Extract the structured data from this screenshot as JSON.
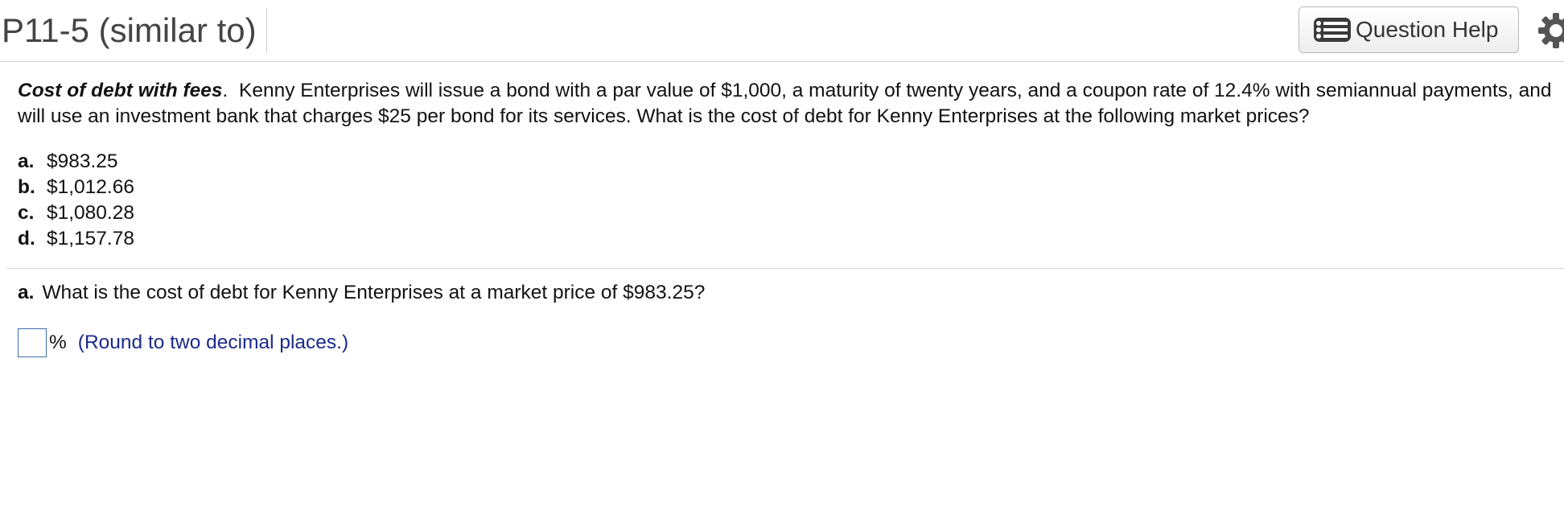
{
  "header": {
    "title": "P11-5 (similar to)",
    "help_label": "Question Help"
  },
  "problem": {
    "lead": "Cost of debt with fees",
    "lead_punct": ".",
    "text": "Kenny Enterprises will issue a bond with a par value of $1,000, a maturity of twenty years, and a coupon rate of 12.4% with semiannual payments, and will use an investment bank that charges $25 per bond for its services.  What is the cost of debt for Kenny Enterprises at the following market prices?"
  },
  "choices": [
    {
      "letter": "a.",
      "value": "$983.25"
    },
    {
      "letter": "b.",
      "value": "$1,012.66"
    },
    {
      "letter": "c.",
      "value": "$1,080.28"
    },
    {
      "letter": "d.",
      "value": "$1,157.78"
    }
  ],
  "question": {
    "letter": "a.",
    "text": "What is the cost of debt for Kenny Enterprises at a market price of $983.25?"
  },
  "answer": {
    "value": "",
    "unit": "%",
    "hint": "(Round to two decimal places.)"
  }
}
